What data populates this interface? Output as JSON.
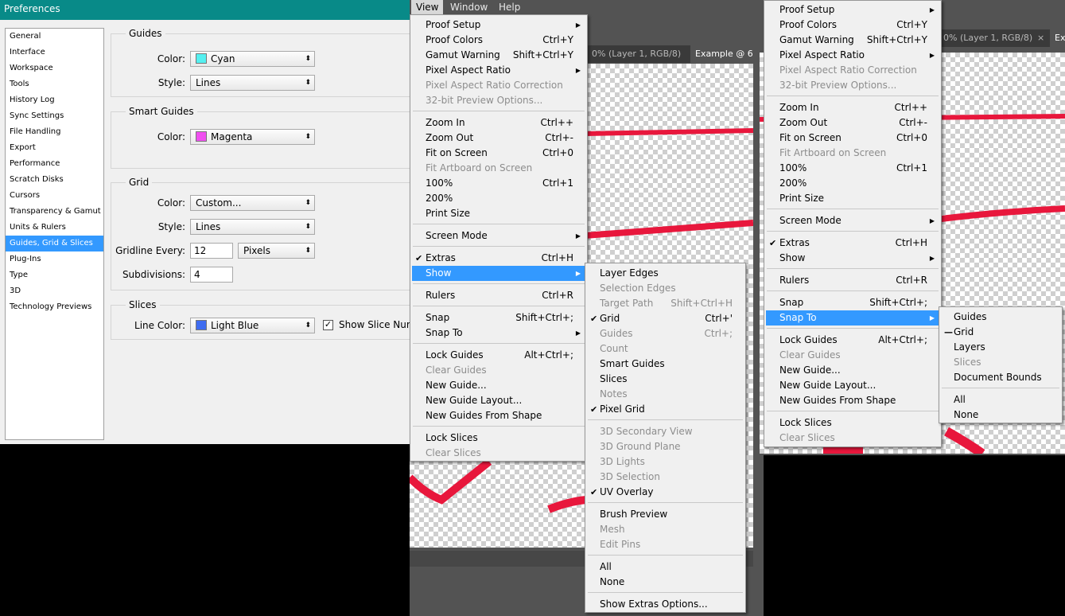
{
  "prefs": {
    "title": "Preferences",
    "nav": [
      "General",
      "Interface",
      "Workspace",
      "Tools",
      "History Log",
      "Sync Settings",
      "File Handling",
      "Export",
      "Performance",
      "Scratch Disks",
      "Cursors",
      "Transparency & Gamut",
      "Units & Rulers",
      "Guides, Grid & Slices",
      "Plug-Ins",
      "Type",
      "3D",
      "Technology Previews"
    ],
    "selected_nav": "Guides, Grid & Slices",
    "guides": {
      "title": "Guides",
      "color_label": "Color:",
      "color_value": "Cyan",
      "color_swatch": "#55f0f0",
      "style_label": "Style:",
      "style_value": "Lines"
    },
    "smart_guides": {
      "title": "Smart Guides",
      "color_label": "Color:",
      "color_value": "Magenta",
      "color_swatch": "#f050f0"
    },
    "grid": {
      "title": "Grid",
      "color_label": "Color:",
      "color_value": "Custom...",
      "style_label": "Style:",
      "style_value": "Lines",
      "gridline_label": "Gridline Every:",
      "gridline_value": "12",
      "gridline_unit": "Pixels",
      "subdiv_label": "Subdivisions:",
      "subdiv_value": "4"
    },
    "slices": {
      "title": "Slices",
      "line_color_label": "Line Color:",
      "line_color_value": "Light Blue",
      "line_color_swatch": "#3f6cf0",
      "show_numbers_label": "Show Slice Num"
    }
  },
  "ps": {
    "menubar": [
      "View",
      "Window",
      "Help"
    ],
    "tabs1": [
      "0% (Layer 1, RGB/8)",
      "Example @ 6"
    ],
    "tabs2": [
      "0% (Layer 1, RGB/8)",
      "×",
      "Ex"
    ],
    "close_glyph": "×",
    "stroke_color": "#e8173c"
  },
  "view_menu": [
    {
      "label": "Proof Setup",
      "shortcut": "",
      "sub": true
    },
    {
      "label": "Proof Colors",
      "shortcut": "Ctrl+Y"
    },
    {
      "label": "Gamut Warning",
      "shortcut": "Shift+Ctrl+Y"
    },
    {
      "label": "Pixel Aspect Ratio",
      "shortcut": "",
      "sub": true
    },
    {
      "label": "Pixel Aspect Ratio Correction",
      "shortcut": "",
      "disabled": true
    },
    {
      "label": "32-bit Preview Options...",
      "shortcut": "",
      "disabled": true
    },
    {
      "sep": true
    },
    {
      "label": "Zoom In",
      "shortcut": "Ctrl++"
    },
    {
      "label": "Zoom Out",
      "shortcut": "Ctrl+-"
    },
    {
      "label": "Fit on Screen",
      "shortcut": "Ctrl+0"
    },
    {
      "label": "Fit Artboard on Screen",
      "shortcut": "",
      "disabled": true
    },
    {
      "label": "100%",
      "shortcut": "Ctrl+1"
    },
    {
      "label": "200%",
      "shortcut": ""
    },
    {
      "label": "Print Size",
      "shortcut": ""
    },
    {
      "sep": true
    },
    {
      "label": "Screen Mode",
      "shortcut": "",
      "sub": true
    },
    {
      "sep": true
    },
    {
      "label": "Extras",
      "shortcut": "Ctrl+H",
      "checked": true
    },
    {
      "label": "Show",
      "shortcut": "",
      "sub": true,
      "highlight": true
    },
    {
      "sep": true
    },
    {
      "label": "Rulers",
      "shortcut": "Ctrl+R"
    },
    {
      "sep": true
    },
    {
      "label": "Snap",
      "shortcut": "Shift+Ctrl+;"
    },
    {
      "label": "Snap To",
      "shortcut": "",
      "sub": true
    },
    {
      "sep": true
    },
    {
      "label": "Lock Guides",
      "shortcut": "Alt+Ctrl+;"
    },
    {
      "label": "Clear Guides",
      "shortcut": "",
      "disabled": true
    },
    {
      "label": "New Guide...",
      "shortcut": ""
    },
    {
      "label": "New Guide Layout...",
      "shortcut": ""
    },
    {
      "label": "New Guides From Shape",
      "shortcut": ""
    },
    {
      "sep": true
    },
    {
      "label": "Lock Slices",
      "shortcut": ""
    },
    {
      "label": "Clear Slices",
      "shortcut": "",
      "disabled": true
    }
  ],
  "show_menu": [
    {
      "label": "Layer Edges",
      "shortcut": ""
    },
    {
      "label": "Selection Edges",
      "shortcut": "",
      "disabled": true
    },
    {
      "label": "Target Path",
      "shortcut": "Shift+Ctrl+H",
      "disabled": true
    },
    {
      "label": "Grid",
      "shortcut": "Ctrl+'",
      "checked": true
    },
    {
      "label": "Guides",
      "shortcut": "Ctrl+;",
      "disabled": true
    },
    {
      "label": "Count",
      "shortcut": "",
      "disabled": true
    },
    {
      "label": "Smart Guides",
      "shortcut": ""
    },
    {
      "label": "Slices",
      "shortcut": ""
    },
    {
      "label": "Notes",
      "shortcut": "",
      "disabled": true
    },
    {
      "label": "Pixel Grid",
      "shortcut": "",
      "checked": true
    },
    {
      "sep": true
    },
    {
      "label": "3D Secondary View",
      "shortcut": "",
      "disabled": true
    },
    {
      "label": "3D Ground Plane",
      "shortcut": "",
      "disabled": true
    },
    {
      "label": "3D Lights",
      "shortcut": "",
      "disabled": true
    },
    {
      "label": "3D Selection",
      "shortcut": "",
      "disabled": true
    },
    {
      "label": "UV Overlay",
      "shortcut": "",
      "checked": true
    },
    {
      "sep": true
    },
    {
      "label": "Brush Preview",
      "shortcut": ""
    },
    {
      "label": "Mesh",
      "shortcut": "",
      "disabled": true
    },
    {
      "label": "Edit Pins",
      "shortcut": "",
      "disabled": true
    },
    {
      "sep": true
    },
    {
      "label": "All",
      "shortcut": ""
    },
    {
      "label": "None",
      "shortcut": ""
    },
    {
      "sep": true
    },
    {
      "label": "Show Extras Options...",
      "shortcut": ""
    }
  ],
  "view_menu2": [
    {
      "label": "Proof Setup",
      "shortcut": "",
      "sub": true
    },
    {
      "label": "Proof Colors",
      "shortcut": "Ctrl+Y"
    },
    {
      "label": "Gamut Warning",
      "shortcut": "Shift+Ctrl+Y"
    },
    {
      "label": "Pixel Aspect Ratio",
      "shortcut": "",
      "sub": true
    },
    {
      "label": "Pixel Aspect Ratio Correction",
      "shortcut": "",
      "disabled": true
    },
    {
      "label": "32-bit Preview Options...",
      "shortcut": "",
      "disabled": true
    },
    {
      "sep": true
    },
    {
      "label": "Zoom In",
      "shortcut": "Ctrl++"
    },
    {
      "label": "Zoom Out",
      "shortcut": "Ctrl+-"
    },
    {
      "label": "Fit on Screen",
      "shortcut": "Ctrl+0"
    },
    {
      "label": "Fit Artboard on Screen",
      "shortcut": "",
      "disabled": true
    },
    {
      "label": "100%",
      "shortcut": "Ctrl+1"
    },
    {
      "label": "200%",
      "shortcut": ""
    },
    {
      "label": "Print Size",
      "shortcut": ""
    },
    {
      "sep": true
    },
    {
      "label": "Screen Mode",
      "shortcut": "",
      "sub": true
    },
    {
      "sep": true
    },
    {
      "label": "Extras",
      "shortcut": "Ctrl+H",
      "checked": true
    },
    {
      "label": "Show",
      "shortcut": "",
      "sub": true
    },
    {
      "sep": true
    },
    {
      "label": "Rulers",
      "shortcut": "Ctrl+R"
    },
    {
      "sep": true
    },
    {
      "label": "Snap",
      "shortcut": "Shift+Ctrl+;"
    },
    {
      "label": "Snap To",
      "shortcut": "",
      "sub": true,
      "highlight": true
    },
    {
      "sep": true
    },
    {
      "label": "Lock Guides",
      "shortcut": "Alt+Ctrl+;"
    },
    {
      "label": "Clear Guides",
      "shortcut": "",
      "disabled": true
    },
    {
      "label": "New Guide...",
      "shortcut": ""
    },
    {
      "label": "New Guide Layout...",
      "shortcut": ""
    },
    {
      "label": "New Guides From Shape",
      "shortcut": ""
    },
    {
      "sep": true
    },
    {
      "label": "Lock Slices",
      "shortcut": ""
    },
    {
      "label": "Clear Slices",
      "shortcut": "",
      "disabled": true
    }
  ],
  "snap_menu": [
    {
      "label": "Guides",
      "shortcut": ""
    },
    {
      "label": "Grid",
      "shortcut": "",
      "dash": true
    },
    {
      "label": "Layers",
      "shortcut": ""
    },
    {
      "label": "Slices",
      "shortcut": "",
      "disabled": true
    },
    {
      "label": "Document Bounds",
      "shortcut": ""
    },
    {
      "sep": true
    },
    {
      "label": "All",
      "shortcut": ""
    },
    {
      "label": "None",
      "shortcut": ""
    }
  ]
}
